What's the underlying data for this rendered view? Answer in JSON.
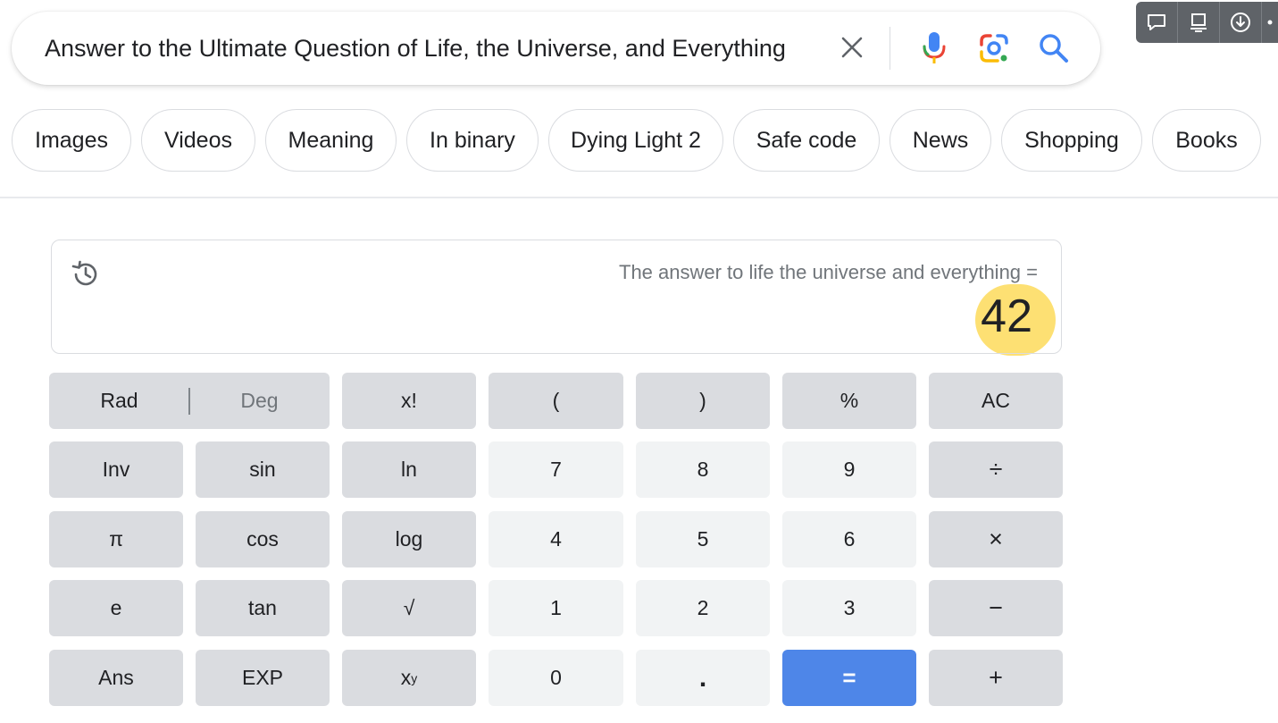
{
  "search": {
    "query": "Answer to the Ultimate Question of Life, the Universe, and Everything",
    "icons": [
      "close-icon",
      "microphone-icon",
      "google-lens-icon",
      "search-icon"
    ]
  },
  "toolbar": {
    "icons": [
      "comment-icon",
      "screen-icon",
      "download-icon",
      "more-icon"
    ]
  },
  "chips": [
    "Images",
    "Videos",
    "Meaning",
    "In binary",
    "Dying Light 2",
    "Safe code",
    "News",
    "Shopping",
    "Books"
  ],
  "calculator": {
    "expression": "The answer to life the universe and everything =",
    "result": "42",
    "angle_mode": {
      "rad": "Rad",
      "deg": "Deg",
      "selected": "Rad"
    },
    "keys": {
      "factorial": "x!",
      "open_paren": "(",
      "close_paren": ")",
      "percent": "%",
      "clear": "AC",
      "inv": "Inv",
      "sin": "sin",
      "ln": "ln",
      "seven": "7",
      "eight": "8",
      "nine": "9",
      "divide": "÷",
      "pi": "π",
      "cos": "cos",
      "log": "log",
      "four": "4",
      "five": "5",
      "six": "6",
      "multiply": "×",
      "e": "e",
      "tan": "tan",
      "sqrt": "√",
      "one": "1",
      "two": "2",
      "three": "3",
      "minus": "−",
      "ans": "Ans",
      "exp": "EXP",
      "power_base": "x",
      "power_exp": "y",
      "zero": "0",
      "decimal": ".",
      "equals": "=",
      "plus": "+"
    }
  },
  "colors": {
    "highlight": "#fde073",
    "equals_key": "#4e86e8",
    "function_key": "#dadce0",
    "number_key": "#f1f3f4"
  }
}
